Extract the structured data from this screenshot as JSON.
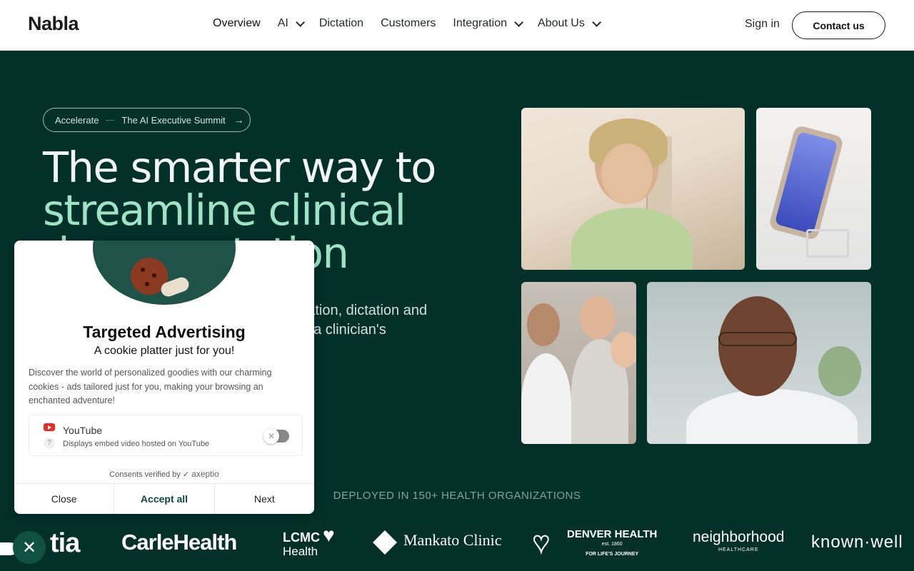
{
  "nav": {
    "logo": "Nabla",
    "links": [
      {
        "label": "Overview",
        "has_dropdown": false
      },
      {
        "label": "AI",
        "has_dropdown": true
      },
      {
        "label": "Dictation",
        "has_dropdown": false
      },
      {
        "label": "Customers",
        "has_dropdown": false
      },
      {
        "label": "Integration",
        "has_dropdown": true
      },
      {
        "label": "About Us",
        "has_dropdown": true
      }
    ],
    "signin": "Sign in",
    "contact": "Contact us"
  },
  "hero": {
    "pill_left": "Accelerate",
    "pill_right": "The AI Executive Summit",
    "pill_arrow": "→",
    "title_line1": "The smarter way to",
    "title_accent": "streamline clinical",
    "title_line3": "documentation",
    "subtext_line1": "AI assistant combining ambient documentation, dictation and",
    "subtext_line2": "coding support, seamlessly integrated into a clinician's workflow."
  },
  "deployed": "DEPLOYED IN 150+ HEALTH ORGANIZATIONS",
  "logos": {
    "tia": "tia",
    "carle": "CarleHealth",
    "lcmc_top": "LCMC",
    "lcmc_bottom": "Health",
    "mankato": "Mankato Clinic",
    "denver": "DENVER HEALTH",
    "denver_est": "est. 1860",
    "denver_tag": "FOR LIFE'S JOURNEY",
    "neighborhood": "neighborhood",
    "neighborhood_sub": "HEALTHCARE",
    "known": "known·well"
  },
  "modal": {
    "title": "Targeted Advertising",
    "subtitle": "A cookie platter just for you!",
    "description": "Discover the world of personalized goodies with our charming cookies - ads tailored just for you, making your browsing an enchanted adventure!",
    "service_name": "YouTube",
    "service_desc": "Displays embed video hosted on YouTube",
    "help_icon": "?",
    "toggle_icon": "✕",
    "verified_prefix": "Consents verified by",
    "verified_brand": "axeptio",
    "close": "Close",
    "accept": "Accept all",
    "next": "Next"
  },
  "fab_icon": "✕",
  "colors": {
    "hero_bg": "#04302a",
    "accent": "#9fe3c7",
    "modal_primary": "#0d4a3c"
  }
}
